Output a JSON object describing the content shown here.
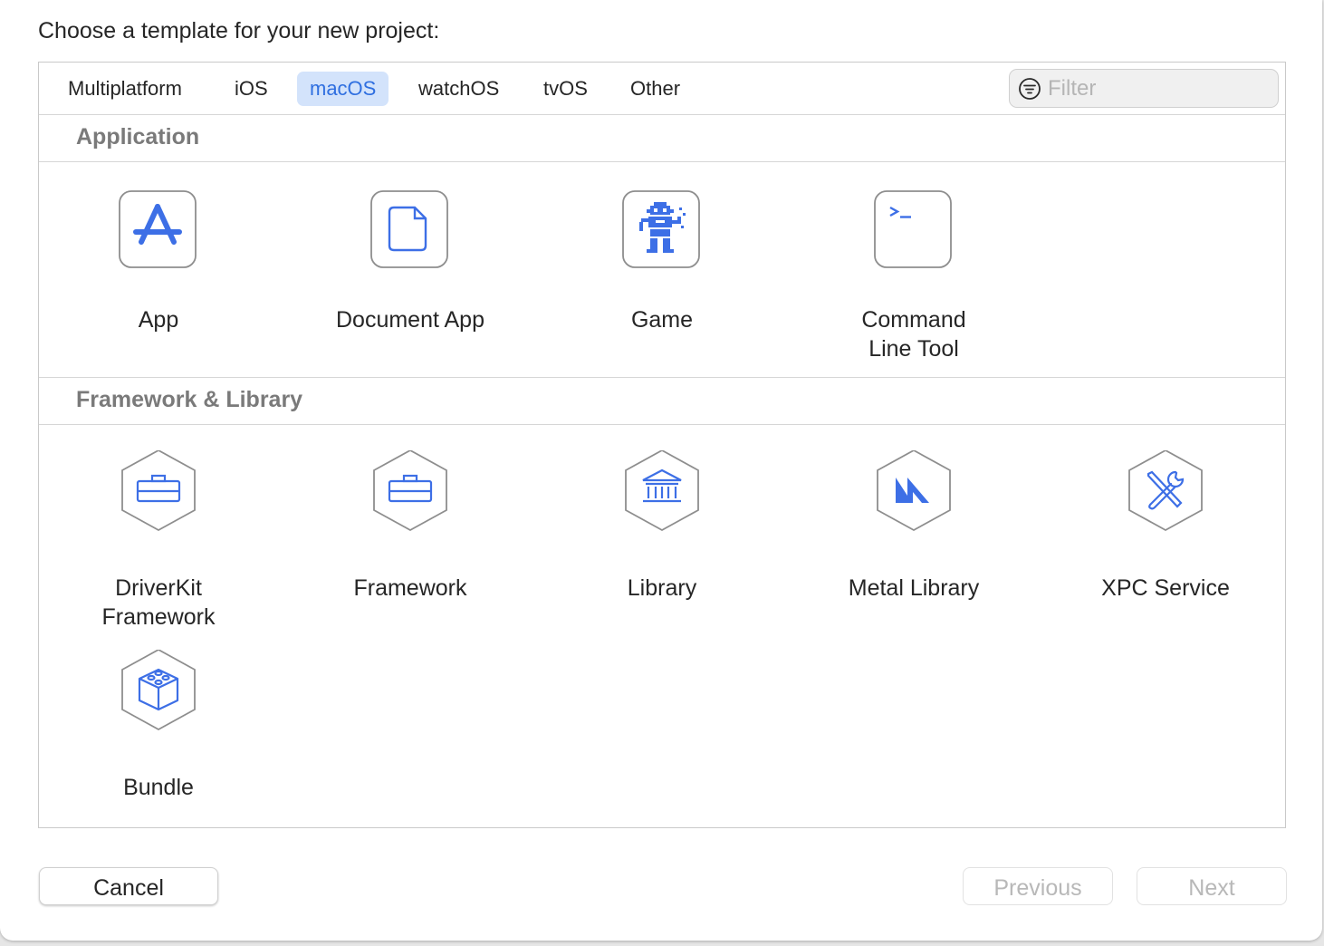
{
  "dialog": {
    "heading": "Choose a template for your new project:"
  },
  "tabs": [
    {
      "label": "Multiplatform",
      "selected": false
    },
    {
      "label": "iOS",
      "selected": false
    },
    {
      "label": "macOS",
      "selected": true
    },
    {
      "label": "watchOS",
      "selected": false
    },
    {
      "label": "tvOS",
      "selected": false
    },
    {
      "label": "Other",
      "selected": false
    }
  ],
  "filter": {
    "placeholder": "Filter",
    "value": ""
  },
  "sections": [
    {
      "title": "Application",
      "items": [
        {
          "label": "App",
          "icon": "app-store-icon"
        },
        {
          "label": "Document App",
          "icon": "document-icon"
        },
        {
          "label": "Game",
          "icon": "game-robot-icon"
        },
        {
          "label": "Command\nLine Tool",
          "icon": "terminal-icon"
        }
      ]
    },
    {
      "title": "Framework & Library",
      "items": [
        {
          "label": "DriverKit\nFramework",
          "icon": "toolbox-icon"
        },
        {
          "label": "Framework",
          "icon": "toolbox-icon"
        },
        {
          "label": "Library",
          "icon": "library-building-icon"
        },
        {
          "label": "Metal Library",
          "icon": "metal-icon"
        },
        {
          "label": "XPC Service",
          "icon": "wrench-screwdriver-icon"
        },
        {
          "label": "Bundle",
          "icon": "lego-cube-icon"
        }
      ]
    }
  ],
  "buttons": {
    "cancel": "Cancel",
    "previous": "Previous",
    "next": "Next"
  },
  "colors": {
    "accent": "#2f6fe0",
    "icon_blue": "#3d6fe6",
    "tab_selected_bg": "#d3e3fb",
    "section_title": "#7a7a7a",
    "disabled_text": "#b8b8b8"
  }
}
